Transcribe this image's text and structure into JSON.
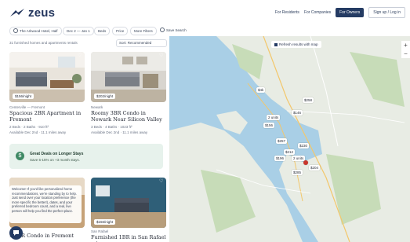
{
  "header": {
    "brand": "zeus",
    "nav": [
      "For Residents",
      "For Companies"
    ],
    "cta_primary": "For Owners",
    "cta_secondary": "Sign up / Log in"
  },
  "filters": {
    "location": "The Arkwood Hotel, Half",
    "dates": "Dec 2 — Jan 1",
    "beds": "Beds",
    "price": "Price",
    "more": "More Filters",
    "save": "Save Search"
  },
  "list": {
    "results_text": "31 furnished homes and apartments rentals",
    "sort_label": "Sort: Recommended",
    "cards": [
      {
        "price": "$156/night",
        "location": "Centerville — Fremont",
        "title": "Spacious 2BR Apartment in Fremont",
        "meta1": "2 Beds · 2 Baths · 910 ft²",
        "meta2": "Available Dec 2nd · 11.1 miles away"
      },
      {
        "price": "$202/night",
        "location": "Newark",
        "title": "Roomy 3BR Condo in Newark Near Silicon Valley",
        "meta1": "3 Beds · 4 Baths · 1023 ft²",
        "meta2": "Available Dec 2nd · 11.1 miles away"
      },
      {
        "price": "",
        "location": "",
        "title": "...2BR Condo in Fremont",
        "meta1": "",
        "meta2": ""
      },
      {
        "price": "$156/night",
        "location": "San Rafael",
        "title": "Furnished 1BR in San Rafael w/",
        "meta1": "",
        "meta2": ""
      }
    ],
    "deal_title": "Great Deals on Longer Stays",
    "deal_sub": "Save 5-15% on +3 month stays.",
    "tooltip_text": "Welcome! If you'd like personalized home recommendations, we're standing by to help. Just send over your location preference (the more specific the better!), dates, and your preferred bedroom count, and a real, live person will help you find the perfect place."
  },
  "map": {
    "refresh_label": "Refresh results with map",
    "zoom_in": "+",
    "zoom_out": "−",
    "pins": [
      "$4k",
      "$258",
      "$146",
      "2 units",
      "$156",
      "$257",
      "$230",
      "$212",
      "$196",
      "2 units",
      "$204",
      "$285"
    ]
  }
}
